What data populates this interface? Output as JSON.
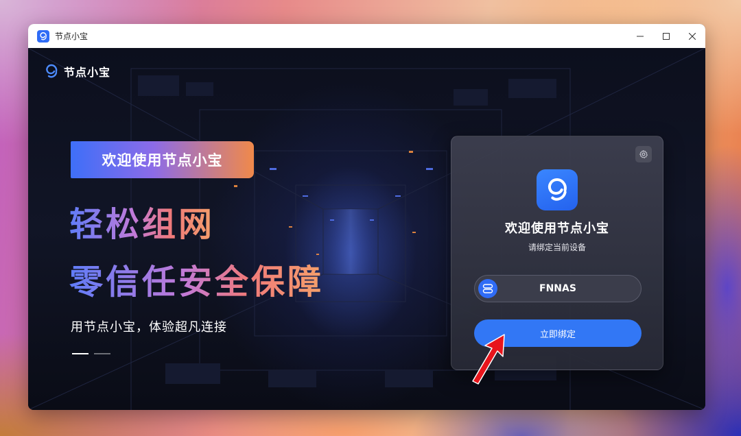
{
  "window": {
    "title": "节点小宝"
  },
  "brand": {
    "name": "节点小宝"
  },
  "hero": {
    "banner": "欢迎使用节点小宝",
    "headline_1": "轻松组网",
    "headline_2": "零信任安全保障",
    "subline": "用节点小宝，体验超凡连接"
  },
  "card": {
    "title": "欢迎使用节点小宝",
    "subtitle": "请绑定当前设备",
    "device_name": "FNNAS",
    "bind_button": "立即绑定"
  },
  "colors": {
    "accent": "#3277f5",
    "annotation_arrow": "#e8151c"
  },
  "icons": {
    "titlebar_logo": "app-logo-icon",
    "settings": "gear-icon",
    "device": "device-icon"
  }
}
